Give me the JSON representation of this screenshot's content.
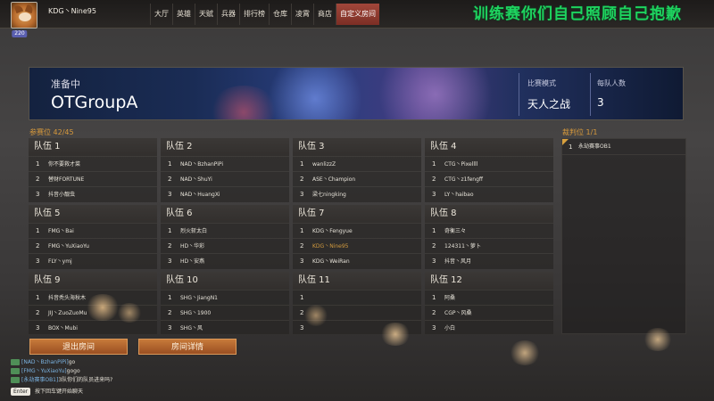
{
  "header": {
    "avatar_level": "220",
    "username": "KDG丶Nine95",
    "nav": [
      "大厅",
      "英雄",
      "天赋",
      "兵器",
      "排行榜",
      "仓库",
      "凌霄",
      "商店",
      "自定义房间"
    ],
    "active_nav": "自定义房间",
    "overlay_text": "训练赛你们自己照顾自己抱歉"
  },
  "banner": {
    "status": "准备中",
    "room_name": "OTGroupA",
    "mode_label": "比赛模式",
    "mode_value": "天人之战",
    "per_team_label": "每队人数",
    "per_team_value": "3"
  },
  "slots": {
    "label": "参赛位",
    "count": "42/45"
  },
  "referee": {
    "label": "裁判位",
    "count": "1/1",
    "members": [
      {
        "idx": "1",
        "name": "永劫赛事OB1"
      }
    ]
  },
  "teams": [
    {
      "name": "队伍 1",
      "members": [
        {
          "idx": "1",
          "name": "你不要救才菜"
        },
        {
          "idx": "2",
          "name": "替财FORTUNE"
        },
        {
          "idx": "3",
          "name": "抖音小靓虫"
        }
      ]
    },
    {
      "name": "队伍 2",
      "members": [
        {
          "idx": "1",
          "name": "NAD丶BzhanPiPi"
        },
        {
          "idx": "2",
          "name": "NAD丶ShuYi"
        },
        {
          "idx": "3",
          "name": "NAD丶HuangXi"
        }
      ]
    },
    {
      "name": "队伍 3",
      "members": [
        {
          "idx": "1",
          "name": "wanlizzZ"
        },
        {
          "idx": "2",
          "name": "ASE丶Champion"
        },
        {
          "idx": "3",
          "name": "梁七ningking"
        }
      ]
    },
    {
      "name": "队伍 4",
      "members": [
        {
          "idx": "1",
          "name": "CTG丶Pixellll"
        },
        {
          "idx": "2",
          "name": "CTG丶z1fengff"
        },
        {
          "idx": "3",
          "name": "LY丶haibao"
        }
      ]
    },
    {
      "name": "队伍 5",
      "members": [
        {
          "idx": "1",
          "name": "FMG丶Bai"
        },
        {
          "idx": "2",
          "name": "FMG丶YuXiaoYu"
        },
        {
          "idx": "3",
          "name": "FLY丶ymj"
        }
      ]
    },
    {
      "name": "队伍 6",
      "members": [
        {
          "idx": "1",
          "name": "烈火斩太白"
        },
        {
          "idx": "2",
          "name": "HD丶华彩"
        },
        {
          "idx": "3",
          "name": "HD丶安燕"
        }
      ]
    },
    {
      "name": "队伍 7",
      "members": [
        {
          "idx": "1",
          "name": "KDG丶Fengyue"
        },
        {
          "idx": "2",
          "name": "KDG丶Nine95",
          "me": true
        },
        {
          "idx": "3",
          "name": "KDG丶WeiRan"
        }
      ]
    },
    {
      "name": "队伍 8",
      "members": [
        {
          "idx": "1",
          "name": "奇衡三々"
        },
        {
          "idx": "2",
          "name": "124311丶萝卜"
        },
        {
          "idx": "3",
          "name": "抖音丶风月"
        }
      ]
    },
    {
      "name": "队伍 9",
      "members": [
        {
          "idx": "1",
          "name": "抖音秃头海秋木"
        },
        {
          "idx": "2",
          "name": "JIJ丶ZuoZuoMu"
        },
        {
          "idx": "3",
          "name": "BOX丶Mubi"
        }
      ]
    },
    {
      "name": "队伍 10",
      "members": [
        {
          "idx": "1",
          "name": "SHG丶JiangN1"
        },
        {
          "idx": "2",
          "name": "SHG丶1900"
        },
        {
          "idx": "3",
          "name": "SHG丶风"
        }
      ]
    },
    {
      "name": "队伍 11",
      "members": [
        {
          "idx": "1",
          "name": ""
        },
        {
          "idx": "2",
          "name": ""
        },
        {
          "idx": "3",
          "name": ""
        }
      ]
    },
    {
      "name": "队伍 12",
      "members": [
        {
          "idx": "1",
          "name": "阿桑"
        },
        {
          "idx": "2",
          "name": "CGP丶风桑"
        },
        {
          "idx": "3",
          "name": "小白"
        }
      ]
    }
  ],
  "buttons": {
    "leave": "退出房间",
    "details": "房间详情"
  },
  "chat": {
    "lines": [
      {
        "sender": "[NAD丶BzhanPiPi]",
        "text": "go"
      },
      {
        "sender": "[FMG丶YuXiaoYu]",
        "text": "gogo"
      },
      {
        "sender": "[永劫赛事OB1]",
        "text": "3队你们的队员进来吗?"
      }
    ],
    "enter_key": "Enter",
    "input_hint": "按下回车键开始聊天"
  },
  "colors": {
    "accent": "#d89a3c",
    "active_nav": "#a1473a",
    "overlay_green": "#1ed35f",
    "button": "#c77a3a"
  }
}
